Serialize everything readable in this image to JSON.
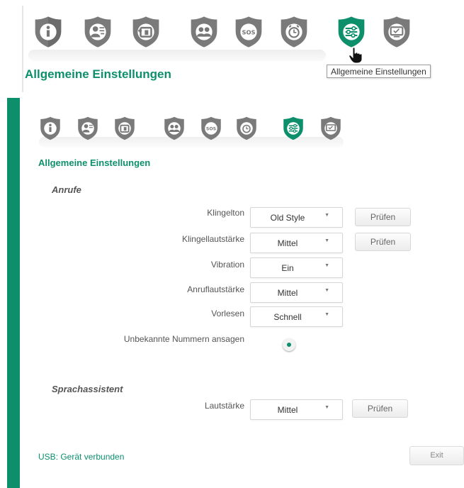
{
  "tooltip": "Allgemeine Einstellungen",
  "nav_icons": [
    "info-icon",
    "contacts-icon",
    "speed-dial-icon",
    "group-icon",
    "sos-icon",
    "alarm-icon",
    "settings-sliders-icon",
    "screen-icon"
  ],
  "nav_icon_text": {
    "sos": "SOS"
  },
  "active_icon": "settings-sliders-icon",
  "page_title": "Allgemeine Einstellungen",
  "sections": {
    "calls": {
      "title": "Anrufe",
      "ringtone": {
        "label": "Klingelton",
        "value": "Old Style",
        "button": "Prüfen"
      },
      "ring_volume": {
        "label": "Klingellautstärke",
        "value": "Mittel",
        "button": "Prüfen"
      },
      "vibration": {
        "label": "Vibration",
        "value": "Ein"
      },
      "call_volume": {
        "label": "Anruflautstärke",
        "value": "Mittel"
      },
      "readout": {
        "label": "Vorlesen",
        "value": "Schnell"
      },
      "announce_unknown": {
        "label": "Unbekannte Nummern ansagen",
        "checked": true
      }
    },
    "assistant": {
      "title": "Sprachassistent",
      "volume": {
        "label": "Lautstärke",
        "value": "Mittel",
        "button": "Prüfen"
      }
    }
  },
  "status": "USB: Gerät verbunden",
  "exit_label": "Exit",
  "colors": {
    "accent": "#0d8f6c",
    "icon_gray": "#777777"
  }
}
